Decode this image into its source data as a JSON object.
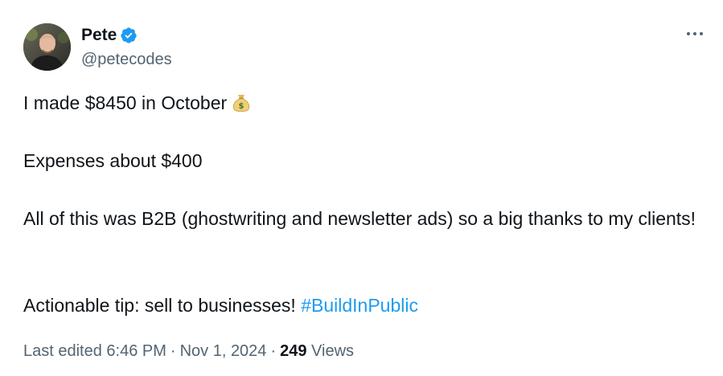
{
  "author": {
    "name": "Pete",
    "handle": "@petecodes",
    "verified": true,
    "avatar_icon": "avatar-photo"
  },
  "tweet": {
    "line1": "I made $8450 in October",
    "line1_emoji": "money-bag-icon",
    "line2": "Expenses about $400",
    "line3": "All of this was B2B (ghostwriting and newsletter ads) so a big thanks to my clients!",
    "line4_text": "Actionable tip: sell to businesses!",
    "hashtag": "#BuildInPublic"
  },
  "meta": {
    "edited_label": "Last edited",
    "time": "6:46 PM",
    "dot": "·",
    "date": "Nov 1, 2024",
    "views_count": "249",
    "views_label": "Views"
  },
  "colors": {
    "text": "#0f1419",
    "secondary": "#536471",
    "accent": "#1d9bf0"
  }
}
